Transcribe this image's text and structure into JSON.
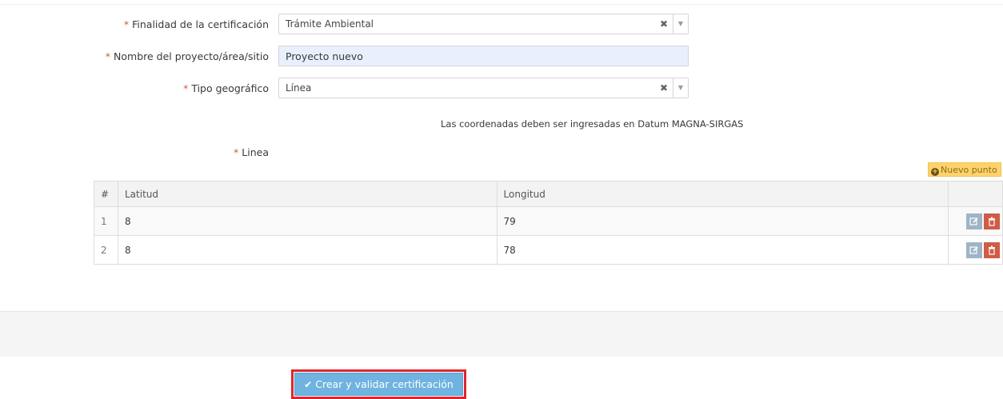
{
  "form": {
    "required_mark": "*",
    "purpose": {
      "label": "Finalidad de la certificación",
      "value": "Trámite Ambiental",
      "clear_symbol": "✖",
      "arrow_symbol": "▼"
    },
    "project_name": {
      "label": "Nombre del proyecto/área/sitio",
      "value": "Proyecto nuevo"
    },
    "geo_type": {
      "label": "Tipo geográfico",
      "value": "Línea",
      "clear_symbol": "✖",
      "arrow_symbol": "▼"
    },
    "note": "Las coordenadas deben ser ingresadas en Datum MAGNA-SIRGAS",
    "line_label": "Linea"
  },
  "points": {
    "new_point_label": "Nuevo punto",
    "plus_symbol": "+",
    "headers": {
      "index": "#",
      "lat": "Latitud",
      "lon": "Longitud"
    },
    "rows": [
      {
        "index": "1",
        "lat": "8",
        "lon": "79"
      },
      {
        "index": "2",
        "lat": "8",
        "lon": "78"
      }
    ]
  },
  "footer": {
    "submit_label": "Crear y validar certificación",
    "check_symbol": "✔"
  },
  "colors": {
    "required": "#d15b47",
    "submit_bg": "#6fb3e0",
    "highlight_outline": "#e0262d",
    "new_point_bg": "#ffd36a",
    "delete_bg": "#d15b47",
    "edit_bg": "#9fb4c5"
  }
}
